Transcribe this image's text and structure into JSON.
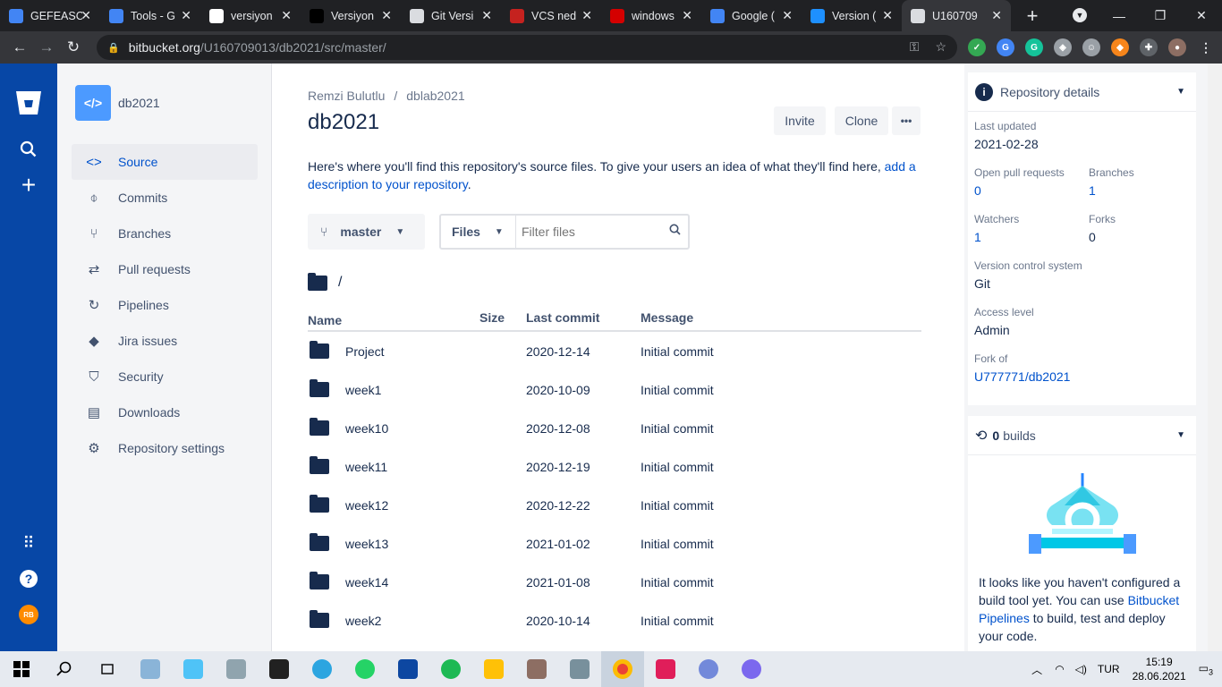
{
  "browser": {
    "tabs": [
      {
        "label": "GEFEASC",
        "icon_color": "#4285f4",
        "icon": "docs-icon"
      },
      {
        "label": "Tools - G",
        "icon_color": "#4285f4",
        "icon": "docs-icon"
      },
      {
        "label": "versiyon",
        "icon_color": "#ffffff",
        "icon": "google-icon"
      },
      {
        "label": "Versiyon",
        "icon_color": "#000000",
        "icon": "medium-icon"
      },
      {
        "label": "Git Versi",
        "icon_color": "#dadce0",
        "icon": "globe-icon"
      },
      {
        "label": "VCS ned",
        "icon_color": "#c5221f",
        "icon": "vcs-icon"
      },
      {
        "label": "windows",
        "icon_color": "#d40000",
        "icon": "news-icon"
      },
      {
        "label": "Google (",
        "icon_color": "#4285f4",
        "icon": "translate-icon"
      },
      {
        "label": "Version (",
        "icon_color": "#1e90ff",
        "icon": "zero-icon"
      },
      {
        "label": "U160709",
        "icon_color": "#dadce0",
        "icon": "globe-icon",
        "active": true
      }
    ],
    "url_domain": "bitbucket.org",
    "url_path": "/U160709013/db2021/src/master/"
  },
  "sidebar": {
    "repo_name": "db2021",
    "items": [
      {
        "label": "Source",
        "icon": "code-icon",
        "glyph": "<>",
        "active": true
      },
      {
        "label": "Commits",
        "icon": "commit-icon",
        "glyph": "⌽"
      },
      {
        "label": "Branches",
        "icon": "branch-icon",
        "glyph": "⑂"
      },
      {
        "label": "Pull requests",
        "icon": "pull-request-icon",
        "glyph": "⇄"
      },
      {
        "label": "Pipelines",
        "icon": "pipelines-icon",
        "glyph": "↻"
      },
      {
        "label": "Jira issues",
        "icon": "jira-icon",
        "glyph": "◆"
      },
      {
        "label": "Security",
        "icon": "shield-icon",
        "glyph": "⛉"
      },
      {
        "label": "Downloads",
        "icon": "document-icon",
        "glyph": "▤"
      },
      {
        "label": "Repository settings",
        "icon": "gear-icon",
        "glyph": "⚙"
      }
    ]
  },
  "main": {
    "breadcrumb_owner": "Remzi Bulutlu",
    "breadcrumb_project": "dblab2021",
    "breadcrumb_sep": "/",
    "title": "db2021",
    "invite_label": "Invite",
    "clone_label": "Clone",
    "more_label": "•••",
    "desc_text": "Here's where you'll find this repository's source files. To give your users an idea of what they'll find here,",
    "desc_link": "add a description to your repository",
    "desc_end": ".",
    "branch": "master",
    "files_label": "Files",
    "filter_placeholder": "Filter files",
    "root_path": "/",
    "columns": {
      "name": "Name",
      "size": "Size",
      "last_commit": "Last commit",
      "message": "Message"
    },
    "rows": [
      {
        "name": "Project",
        "size": "",
        "date": "2020-12-14",
        "message": "Initial commit"
      },
      {
        "name": "week1",
        "size": "",
        "date": "2020-10-09",
        "message": "Initial commit"
      },
      {
        "name": "week10",
        "size": "",
        "date": "2020-12-08",
        "message": "Initial commit"
      },
      {
        "name": "week11",
        "size": "",
        "date": "2020-12-19",
        "message": "Initial commit"
      },
      {
        "name": "week12",
        "size": "",
        "date": "2020-12-22",
        "message": "Initial commit"
      },
      {
        "name": "week13",
        "size": "",
        "date": "2021-01-02",
        "message": "Initial commit"
      },
      {
        "name": "week14",
        "size": "",
        "date": "2021-01-08",
        "message": "Initial commit"
      },
      {
        "name": "week2",
        "size": "",
        "date": "2020-10-14",
        "message": "Initial commit"
      }
    ]
  },
  "details": {
    "header": "Repository details",
    "last_updated_label": "Last updated",
    "last_updated": "2021-02-28",
    "open_prs_label": "Open pull requests",
    "open_prs": "0",
    "branches_label": "Branches",
    "branches": "1",
    "watchers_label": "Watchers",
    "watchers": "1",
    "forks_label": "Forks",
    "forks": "0",
    "vcs_label": "Version control system",
    "vcs": "Git",
    "access_label": "Access level",
    "access": "Admin",
    "fork_of_label": "Fork of",
    "fork_of": "U777771/db2021"
  },
  "builds": {
    "count": "0",
    "label": "builds",
    "text": "It looks like you haven't configured a build tool yet. You can use",
    "link": "Bitbucket Pipelines",
    "text_end": "to build, test and deploy your code."
  },
  "taskbar": {
    "lang": "TUR",
    "time": "15:19",
    "date": "28.06.2021",
    "notifications": "3"
  },
  "user_initials": "RB",
  "colors": {
    "brand": "#0747a6",
    "link": "#0052cc",
    "sidebar_bg": "#f4f5f7"
  }
}
